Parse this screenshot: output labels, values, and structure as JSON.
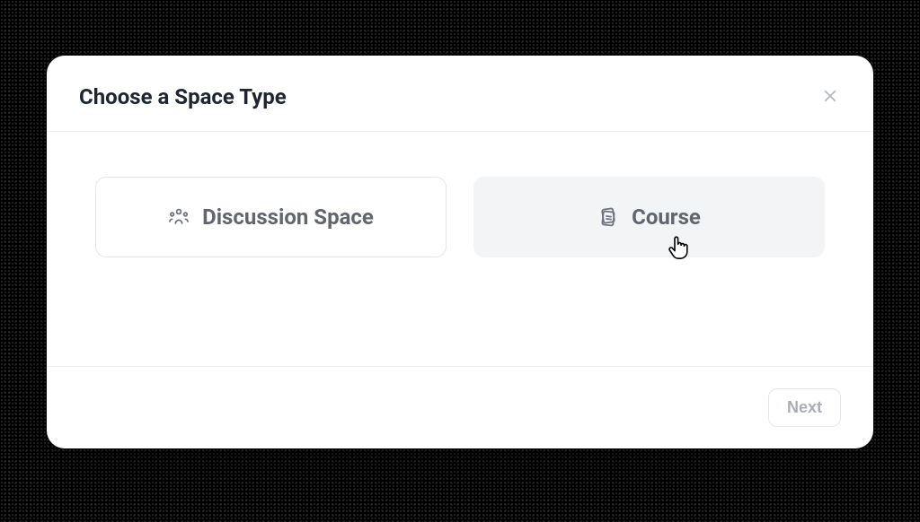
{
  "modal": {
    "title": "Choose a Space Type",
    "options": [
      {
        "label": "Discussion Space",
        "icon": "people-icon"
      },
      {
        "label": "Course",
        "icon": "cards-icon"
      }
    ],
    "next_label": "Next"
  }
}
